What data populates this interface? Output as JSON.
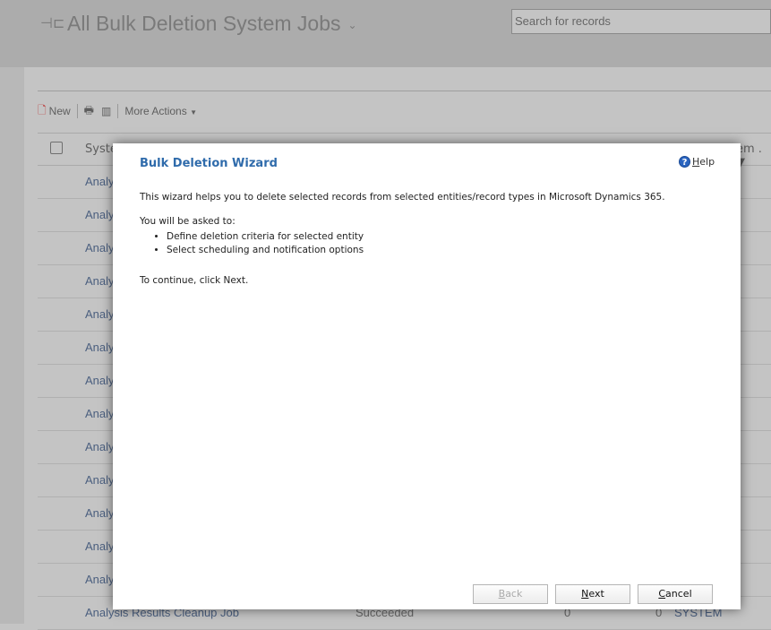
{
  "header": {
    "title": "All Bulk Deletion System Jobs",
    "search_placeholder": "Search for records"
  },
  "toolbar": {
    "new_label": "New",
    "more_actions_label": "More Actions"
  },
  "grid": {
    "columns": [
      "Syste",
      "em ."
    ],
    "rows": [
      {
        "name": "Analy"
      },
      {
        "name": "Analy"
      },
      {
        "name": "Analy"
      },
      {
        "name": "Analy"
      },
      {
        "name": "Analy"
      },
      {
        "name": "Analy"
      },
      {
        "name": "Analy"
      },
      {
        "name": "Analy"
      },
      {
        "name": "Analy"
      },
      {
        "name": "Analy"
      },
      {
        "name": "Analy"
      },
      {
        "name": "Analy"
      },
      {
        "name": "Analy"
      },
      {
        "name": "Analysis Results Cleanup Job",
        "status": "Succeeded",
        "c1": "0",
        "c2": "0",
        "owner": "SYSTEM"
      }
    ]
  },
  "dialog": {
    "title": "Bulk Deletion Wizard",
    "help_label": "Help",
    "intro": "This wizard helps you to delete selected records from selected entities/record types in Microsoft Dynamics 365.",
    "asked": "You will be asked to:",
    "steps": [
      "Define deletion criteria for selected entity",
      "Select scheduling and notification options"
    ],
    "continue": "To continue, click Next.",
    "buttons": {
      "back": "Back",
      "next": "Next",
      "cancel": "Cancel"
    }
  }
}
